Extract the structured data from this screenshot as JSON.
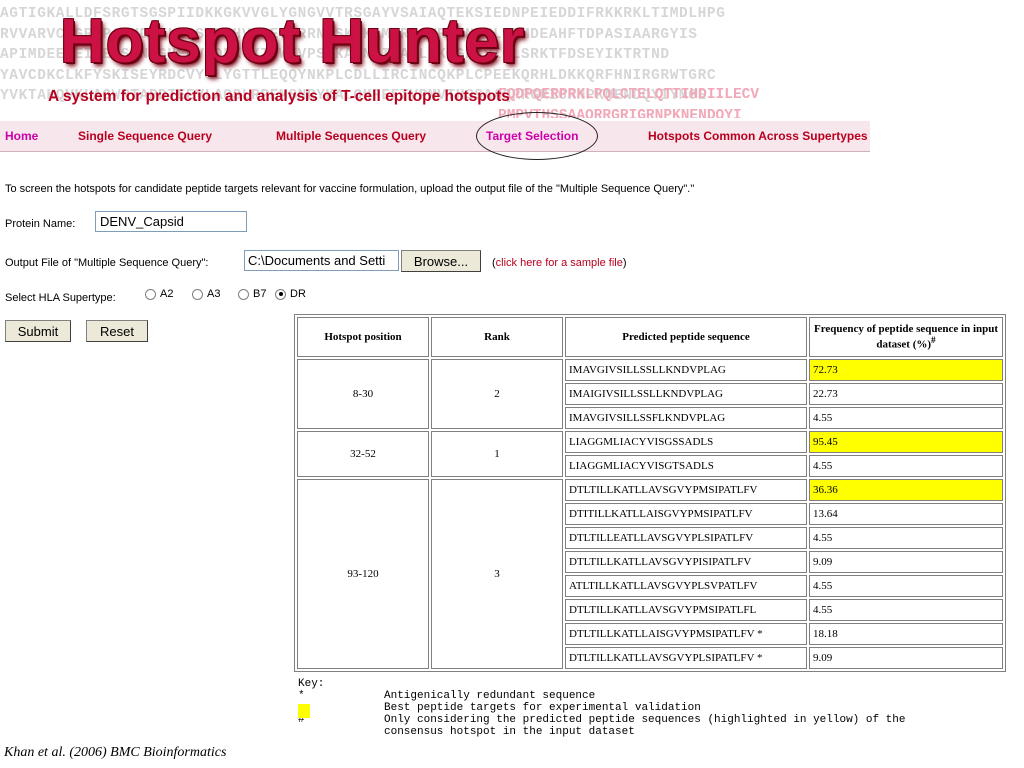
{
  "banner": {
    "background_sequence": [
      "AGTIGKALLDFSRGTSGSPIIDKKGKVVGLYGNGVVTRSGAYVSAIAQTEKSIEDNPEIEDDIFRKKRKLTIMDLHPG",
      "RVVARVCSGRMPAAMDVKLSQSEELHVSQEVTRRNGSKKKLMGRTGVRVPNYNLIIMDEAHFTDPASIAARGYIS",
      "APIMDEEREIPERSWNSGHEWVTDFKGKTVWFVPSIKAGNDIAACLRKNGKKVIQLSRKTFDSEYIKTRTND",
      "YAVCDKCLKFYSKISEYRDCVYSLYGTTLEQQYNKPLCDLLIRCINCQKPLCPEEKQRHLDKKQRFHNIRGRWTGRC",
      "YVKTAKQVKLAGWRTAPDTEEVLAQSLRPEMSNRYKALQHFEFTVPMVTHSSAAQRRGRIGRNPKNENDQYIYMGE"
    ],
    "pink_sequence": [
      "FQDPQERPRKLPQLCTELQTTIHDIILECV",
      "PMPVTHSSAAQRRGRIGRNPKNENDQYI"
    ],
    "logo_text": "Hotspot Hunter",
    "subtitle": "A system for prediction and analysis of T-cell epitope hotspots"
  },
  "nav": {
    "home": "Home",
    "single": "Single Sequence Query",
    "multi": "Multiple Sequences Query",
    "target": "Target Selection",
    "common": "Hotspots Common Across Supertypes"
  },
  "form": {
    "intro": "To screen the hotspots for candidate peptide targets relevant for vaccine formulation, upload the output file of the \"Multiple Sequence Query\".\"",
    "protein_label": "Protein Name:",
    "protein_value": "DENV_Capsid",
    "output_label": "Output File of \"Multiple Sequence Query\":",
    "file_value": "C:\\Documents and Setti",
    "browse_label": "Browse...",
    "sample_open": "(",
    "sample_link": "click here for a sample file",
    "sample_close": ")",
    "hla_label": "Select HLA Supertype:",
    "hla_options": [
      "A2",
      "A3",
      "B7",
      "DR"
    ],
    "hla_selected": "DR",
    "submit_label": "Submit",
    "reset_label": "Reset"
  },
  "table": {
    "headers": [
      "Hotspot position",
      "Rank",
      "Predicted peptide sequence",
      "Frequency of peptide sequence in input dataset (%)"
    ],
    "header_mark": "#",
    "groups": [
      {
        "position": "8-30",
        "rank": "2",
        "rows": [
          {
            "seq": "IMAVGIVSILLSSLLKNDVPLAG",
            "freq": "72.73",
            "highlight": true
          },
          {
            "seq": "IMAIGIVSILLSSLLKNDVPLAG",
            "freq": "22.73",
            "highlight": false
          },
          {
            "seq": "IMAVGIVSILLSSFLKNDVPLAG",
            "freq": "4.55",
            "highlight": false
          }
        ]
      },
      {
        "position": "32-52",
        "rank": "1",
        "rows": [
          {
            "seq": "LIAGGMLIACYVISGSSADLS",
            "freq": "95.45",
            "highlight": true
          },
          {
            "seq": "LIAGGMLIACYVISGTSADLS",
            "freq": "4.55",
            "highlight": false
          }
        ]
      },
      {
        "position": "93-120",
        "rank": "3",
        "rows": [
          {
            "seq": "DTLTILLKATLLAVSGVYPMSIPATLFV",
            "freq": "36.36",
            "highlight": true
          },
          {
            "seq": "DTITILLKATLLAISGVYPMSIPATLFV",
            "freq": "13.64",
            "highlight": false
          },
          {
            "seq": "DTLTILLEATLLAVSGVYPLSIPATLFV",
            "freq": "4.55",
            "highlight": false
          },
          {
            "seq": "DTLTILLKATLLAVSGVYPISIPATLFV",
            "freq": "9.09",
            "highlight": false
          },
          {
            "seq": "ATLTILLKATLLAVSGVYPLSVPATLFV",
            "freq": "4.55",
            "highlight": false
          },
          {
            "seq": "DTLTILLKATLLAVSGVYPMSIPATLFL",
            "freq": "4.55",
            "highlight": false
          },
          {
            "seq": "DTLTILLKATLLAISGVYPMSIPATLFV *",
            "freq": "18.18",
            "highlight": false
          },
          {
            "seq": "DTLTILLKATLLAVSGVYPLSIPATLFV *",
            "freq": "9.09",
            "highlight": false
          }
        ]
      }
    ]
  },
  "key": {
    "title": "Key:",
    "lines": [
      {
        "symbol": "*",
        "text": "Antigenically redundant sequence"
      },
      {
        "symbol": "",
        "text": "Best peptide targets for experimental validation"
      },
      {
        "symbol": "#",
        "text": "Only considering the predicted peptide sequences (highlighted in yellow) of the"
      },
      {
        "symbol": "",
        "text": "consensus hotspot in the input dataset"
      }
    ]
  },
  "citation": "Khan et al. (2006) BMC Bioinformatics",
  "colors": {
    "highlight": "#ffff00",
    "brand_red": "#cc1144",
    "nav_magenta": "#cc00aa"
  }
}
